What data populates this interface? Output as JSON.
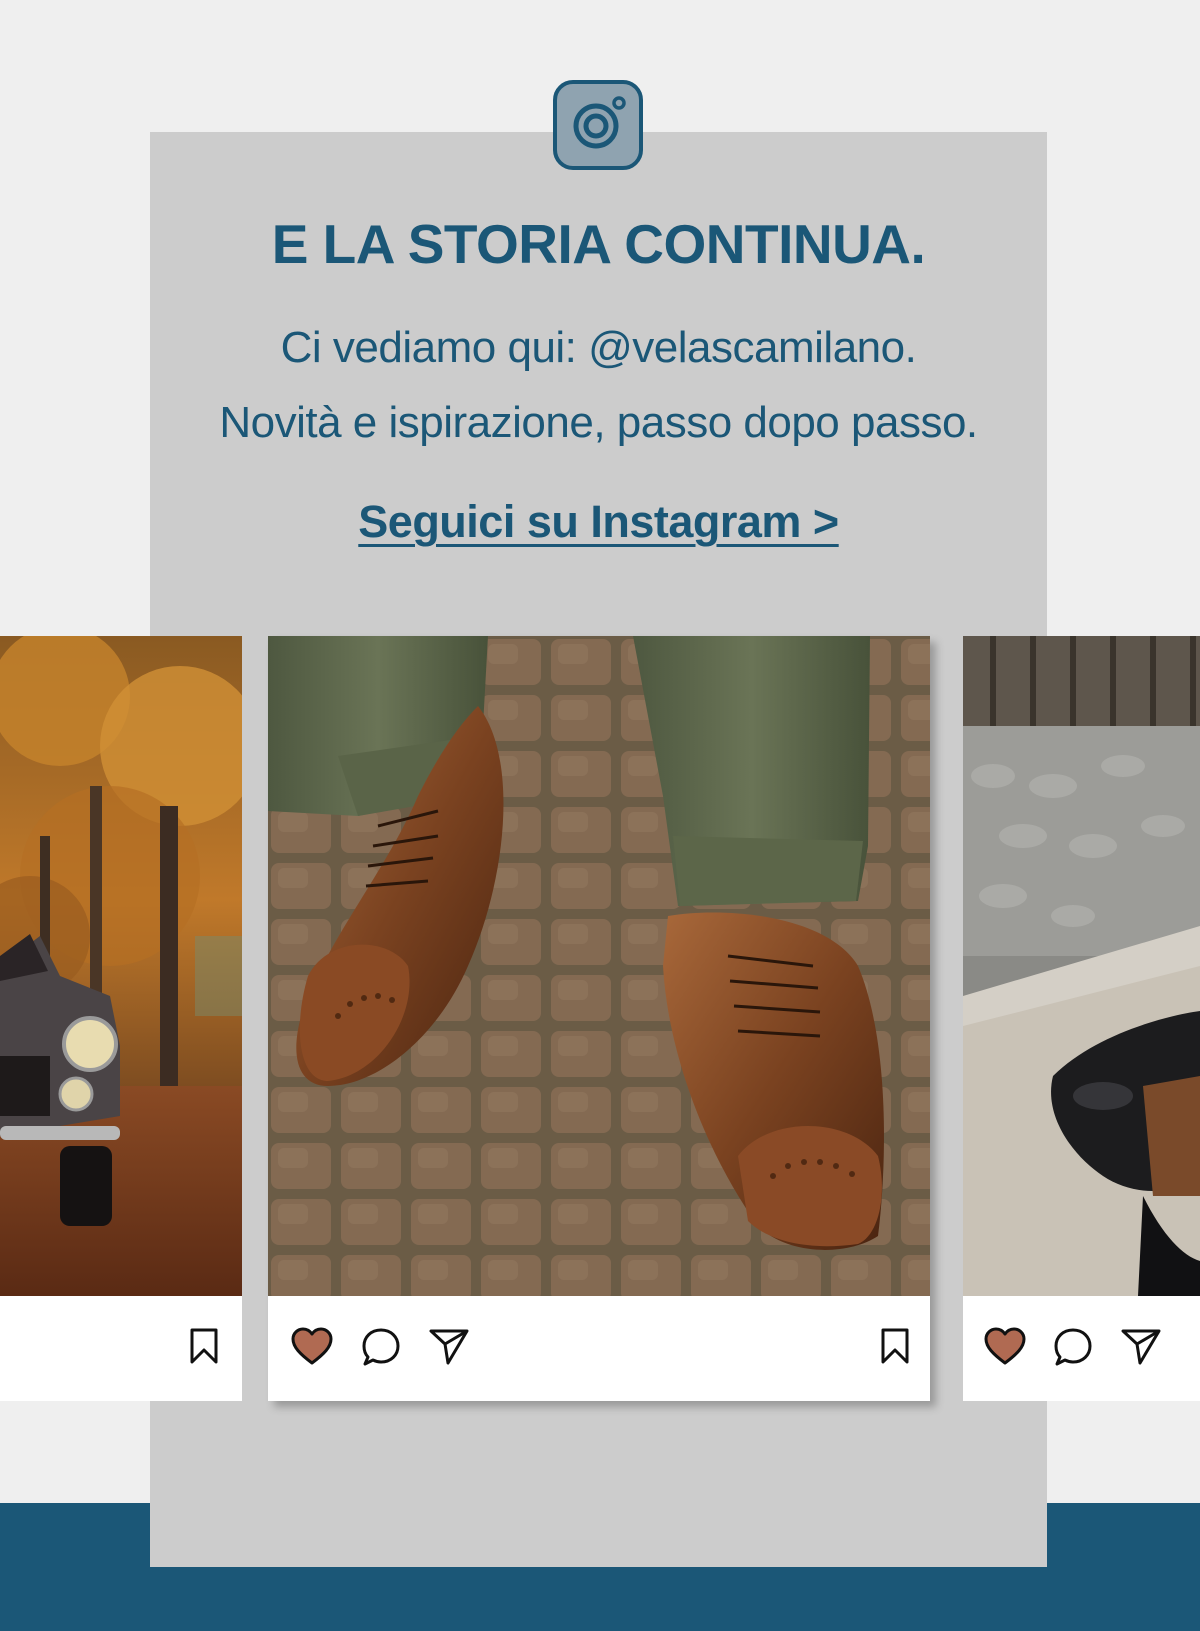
{
  "header": {
    "title": "E LA STORIA CONTINUA.",
    "subtitle_line1": "Ci vediamo qui: @velascamilano.",
    "subtitle_line2": "Novità e ispirazione, passo dopo passo.",
    "cta_label": "Seguici su Instagram >"
  },
  "icons": {
    "logo": "instagram-icon",
    "like": "heart-icon",
    "comment": "comment-icon",
    "share": "send-icon",
    "save": "bookmark-icon"
  },
  "colors": {
    "brand_blue": "#1b5777",
    "panel_gray": "#cccccc",
    "page_bg": "#efefef",
    "heart_fill": "#b06a52"
  },
  "posts": [
    {
      "image": "classic silver car on autumn tree-lined road"
    },
    {
      "image": "brown cap-toe brogue oxford shoes on cobblestones with olive trousers"
    },
    {
      "image": "black leather shoes on stone steps"
    }
  ]
}
